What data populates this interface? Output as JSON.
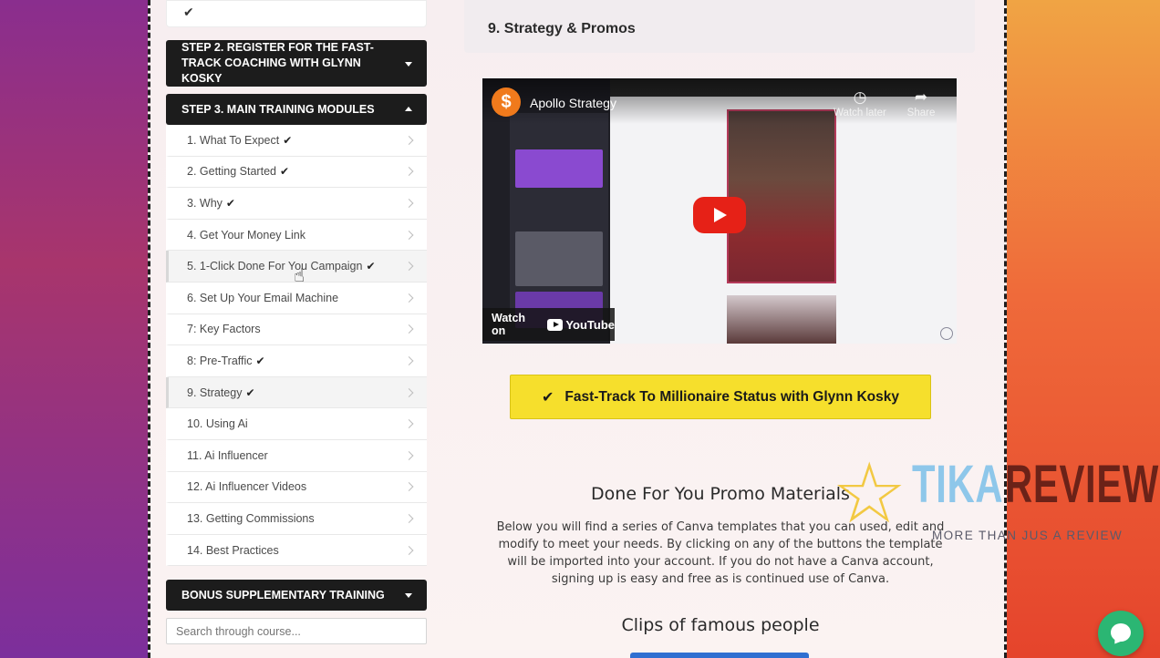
{
  "sidebar": {
    "prev_item_check": "✔",
    "step2_header": "STEP 2. REGISTER FOR THE FAST-TRACK COACHING WITH GLYNN KOSKY",
    "step3_header": "STEP 3. MAIN TRAINING MODULES",
    "modules": [
      {
        "label": "1. What To Expect",
        "done": "✔"
      },
      {
        "label": "2. Getting Started",
        "done": "✔"
      },
      {
        "label": "3. Why",
        "done": "✔"
      },
      {
        "label": "4. Get Your Money Link",
        "done": ""
      },
      {
        "label": "5. 1-Click Done For You Campaign",
        "done": "✔"
      },
      {
        "label": "6. Set Up Your Email Machine",
        "done": ""
      },
      {
        "label": "7: Key Factors",
        "done": ""
      },
      {
        "label": "8: Pre-Traffic",
        "done": "✔"
      },
      {
        "label": "9. Strategy",
        "done": "✔"
      },
      {
        "label": "10. Using Ai",
        "done": ""
      },
      {
        "label": "11. Ai Influencer",
        "done": ""
      },
      {
        "label": "12. Ai Influencer Videos",
        "done": ""
      },
      {
        "label": "13. Getting Commissions",
        "done": ""
      },
      {
        "label": "14. Best Practices",
        "done": ""
      }
    ],
    "bonus_header": "BONUS SUPPLEMENTARY TRAINING",
    "search_placeholder": "Search through course..."
  },
  "main": {
    "lesson_title": "9. Strategy & Promos",
    "video": {
      "channel_logo": "$",
      "title": "Apollo Strategy",
      "watch_later": "Watch later",
      "share": "Share",
      "watch_on": "Watch on",
      "youtube": "YouTube"
    },
    "cta_label": "Fast-Track To Millionaire Status with Glynn Kosky",
    "section_title": "Done For You Promo Materials",
    "description": "Below you will find a series of Canva templates that you can used, edit and modify to meet your needs. By clicking on any of the buttons the template will be imported into your account. If you do not have a Canva account, signing up is easy and free as is continued use of Canva.",
    "clips_title": "Clips of famous people"
  },
  "watermark": {
    "brand_a": "TIKA",
    "brand_b": "REVIEW",
    "tagline": "MORE THAN JUS A REVIEW"
  },
  "colors": {
    "cta_yellow": "#f6df2c",
    "sidebar_dark": "#1c1c1c",
    "chat_green": "#2bb673",
    "youtube_red": "#e62117"
  }
}
